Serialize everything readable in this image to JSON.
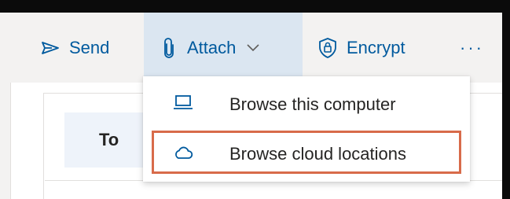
{
  "toolbar": {
    "send_label": "Send",
    "attach_label": "Attach",
    "encrypt_label": "Encrypt",
    "more_label": "···"
  },
  "compose": {
    "to_label": "To"
  },
  "attach_menu": {
    "items": [
      {
        "label": "Browse this computer",
        "icon": "laptop-icon"
      },
      {
        "label": "Browse cloud locations",
        "icon": "cloud-icon",
        "highlighted": true
      }
    ]
  },
  "colors": {
    "accent": "#005a9e",
    "toolbar_bg": "#f3f2f1",
    "attach_active_bg": "#dbe6f1",
    "highlight_border": "#d86b4a"
  }
}
